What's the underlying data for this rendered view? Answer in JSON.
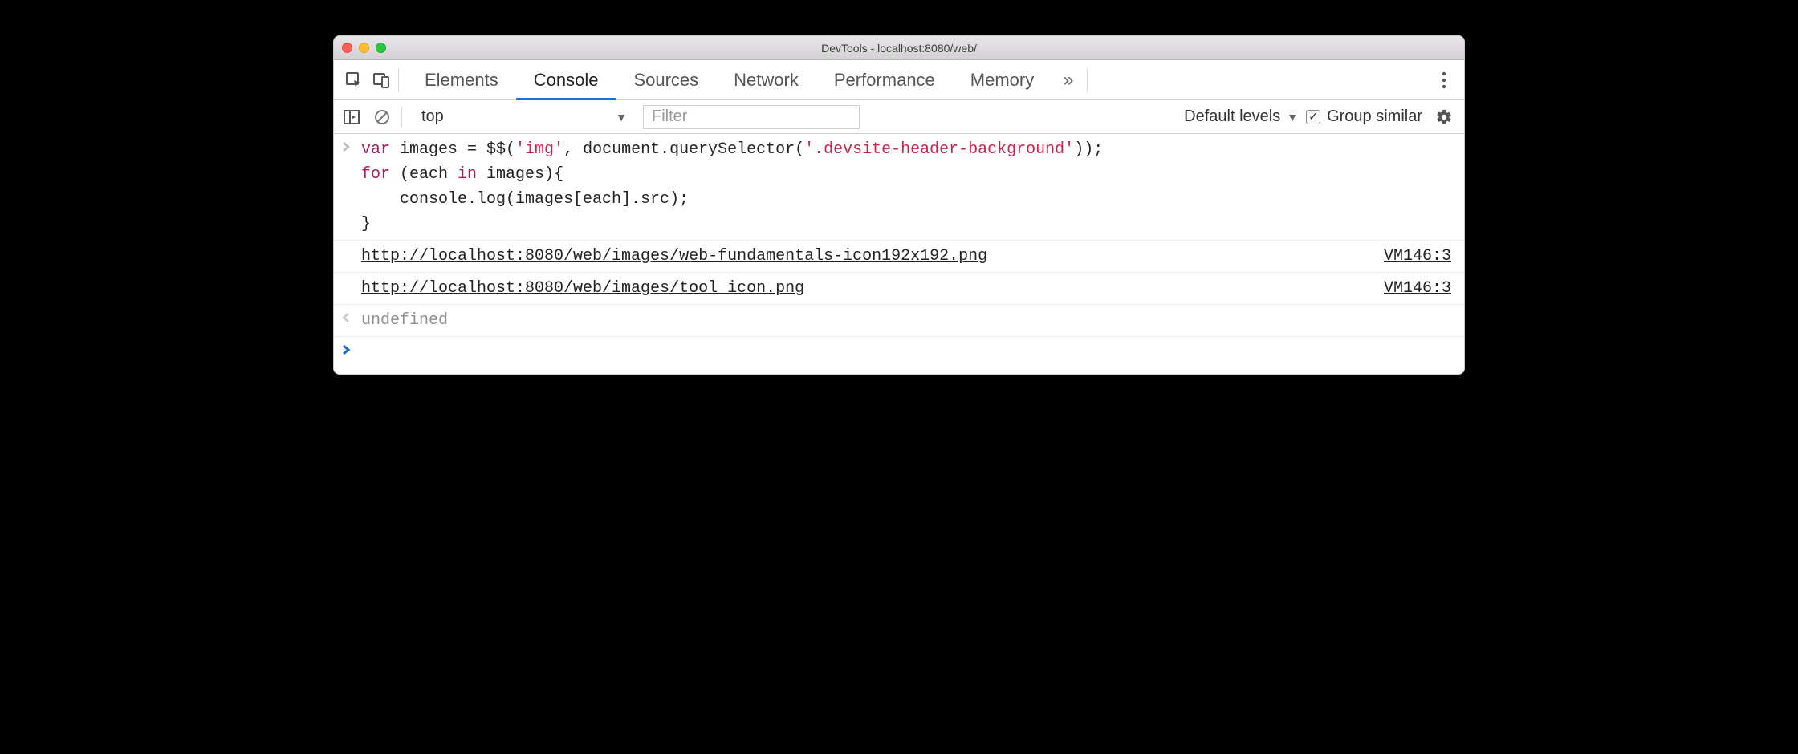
{
  "window": {
    "title": "DevTools - localhost:8080/web/"
  },
  "tabs": {
    "items": [
      "Elements",
      "Console",
      "Sources",
      "Network",
      "Performance",
      "Memory"
    ],
    "active_index": 1,
    "overflow_glyph": "»"
  },
  "console_toolbar": {
    "context": "top",
    "filter_placeholder": "Filter",
    "levels_label": "Default levels",
    "group_similar_label": "Group similar",
    "group_similar_checked": true
  },
  "console": {
    "input_code_html": "<span class=\"kw\">var</span> images = $$(<span class=\"str\">'img'</span>, document.querySelector(<span class=\"str\">'.devsite-header-background'</span>));\n<span class=\"kw\">for</span> (each <span class=\"kw\">in</span> images){\n    console.log(images[each].src);\n}",
    "logs": [
      {
        "text": "http://localhost:8080/web/images/web-fundamentals-icon192x192.png",
        "source": "VM146:3"
      },
      {
        "text": "http://localhost:8080/web/images/tool_icon.png",
        "source": "VM146:3"
      }
    ],
    "return_value": "undefined"
  }
}
